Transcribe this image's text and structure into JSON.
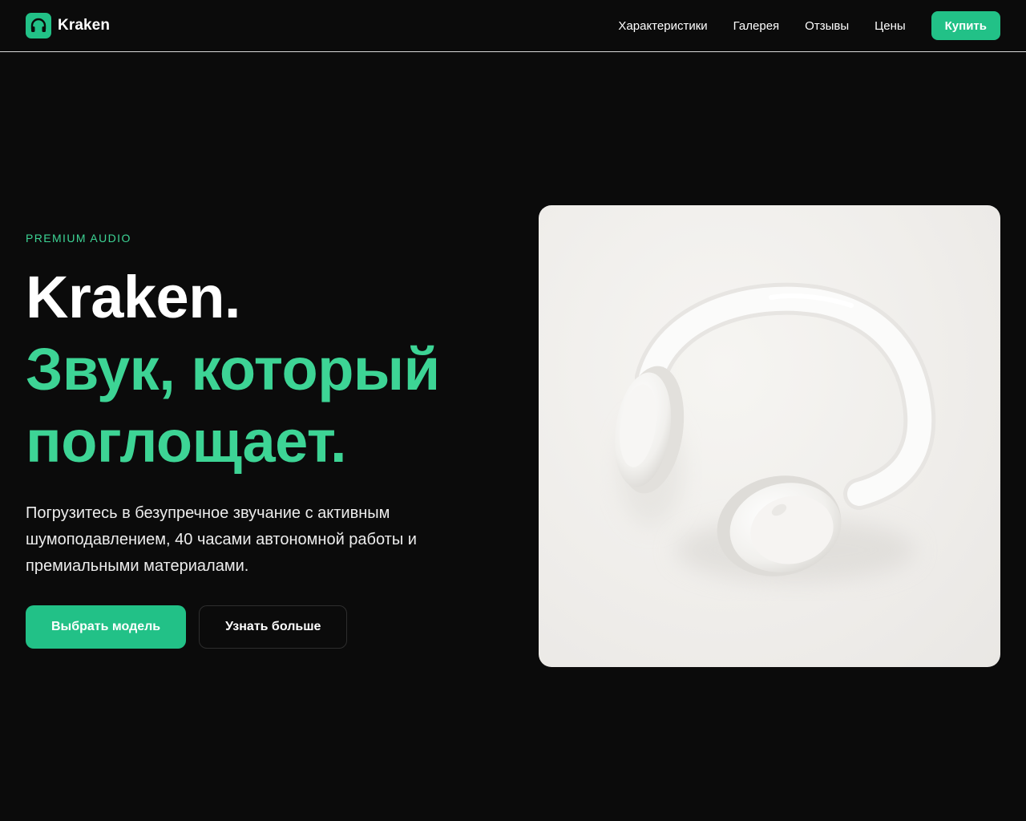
{
  "brand": {
    "name": "Kraken",
    "logo_icon": "headphones-icon",
    "accent_color": "#22c187"
  },
  "nav": {
    "links": [
      "Характеристики",
      "Галерея",
      "Отзывы",
      "Цены"
    ],
    "buy_label": "Купить"
  },
  "hero": {
    "eyebrow": "PREMIUM AUDIO",
    "headline_line1": "Kraken.",
    "headline_line2": "Звук, который",
    "headline_line3": "поглощает.",
    "description": "Погрузитесь в безупречное звучание с активным шумоподавлением, 40 часами автономной работы и премиальными материалами.",
    "primary_cta": "Выбрать модель",
    "secondary_cta": "Узнать больше",
    "image": "white-headphones-photo",
    "highlight_color": "#3dd495",
    "background_color": "#0b0b0b"
  }
}
